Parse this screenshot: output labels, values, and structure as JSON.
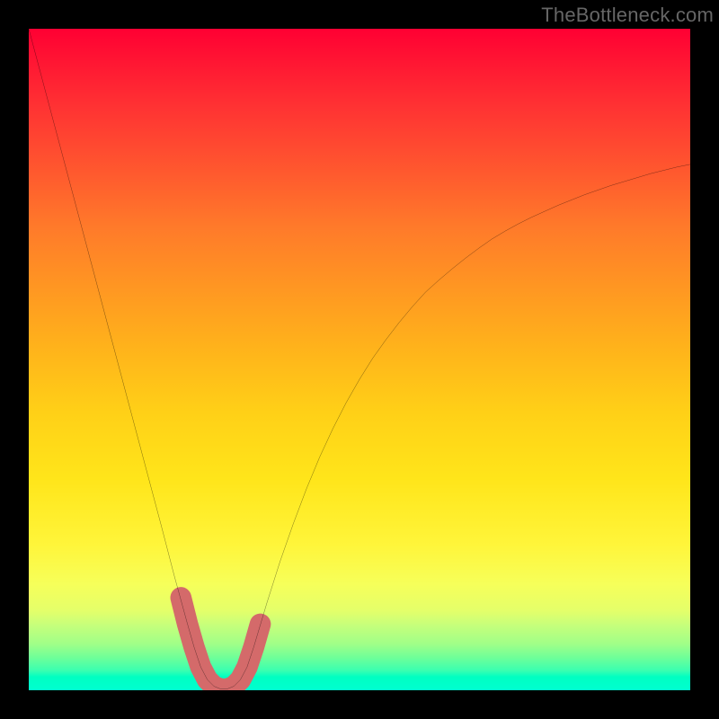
{
  "watermark": {
    "text": "TheBottleneck.com"
  },
  "chart_data": {
    "type": "line",
    "title": "",
    "xlabel": "",
    "ylabel": "",
    "xlim": [
      0,
      100
    ],
    "ylim": [
      0,
      100
    ],
    "grid": false,
    "legend": false,
    "x": [
      0,
      2,
      4,
      6,
      8,
      10,
      12,
      14,
      16,
      18,
      20,
      22,
      24,
      25,
      26,
      27,
      28,
      29,
      30,
      31,
      32,
      33,
      34,
      36,
      38,
      40,
      42,
      44,
      46,
      48,
      50,
      52,
      54,
      56,
      58,
      60,
      62,
      64,
      66,
      68,
      70,
      72,
      74,
      76,
      78,
      80,
      82,
      84,
      86,
      88,
      90,
      92,
      94,
      96,
      98,
      100
    ],
    "series": [
      {
        "name": "curve",
        "color": "#000000",
        "values": [
          100,
          92.5,
          85,
          77.5,
          70,
          62.5,
          55,
          47.5,
          40,
          32.5,
          25,
          17.3,
          10.0,
          6.5,
          3.5,
          1.6,
          0.6,
          0.2,
          0.2,
          0.6,
          1.6,
          3.5,
          6.5,
          13.2,
          19.5,
          25.2,
          30.5,
          35.3,
          39.6,
          43.5,
          47.0,
          50.2,
          53.0,
          55.6,
          58.0,
          60.2,
          62.0,
          63.7,
          65.3,
          66.8,
          68.2,
          69.4,
          70.5,
          71.5,
          72.4,
          73.3,
          74.1,
          74.9,
          75.6,
          76.3,
          76.9,
          77.5,
          78.1,
          78.6,
          79.1,
          79.5
        ]
      }
    ],
    "highlight_band": {
      "color": "#d46a6a",
      "x": [
        23,
        24,
        25,
        26,
        27,
        28,
        29,
        30,
        31,
        32,
        33,
        34,
        35
      ],
      "values": [
        14.0,
        10.0,
        6.5,
        3.5,
        1.6,
        0.6,
        0.2,
        0.2,
        0.6,
        1.6,
        3.5,
        6.5,
        10.0
      ]
    },
    "background": {
      "direction": "vertical",
      "stops": [
        [
          0,
          "#ff0033"
        ],
        [
          12,
          "#ff3333"
        ],
        [
          30,
          "#ff7a2a"
        ],
        [
          48,
          "#ffb21b"
        ],
        [
          68,
          "#ffe51a"
        ],
        [
          84,
          "#f6ff5a"
        ],
        [
          93,
          "#a0ff88"
        ],
        [
          100,
          "#00ffd0"
        ]
      ]
    }
  }
}
